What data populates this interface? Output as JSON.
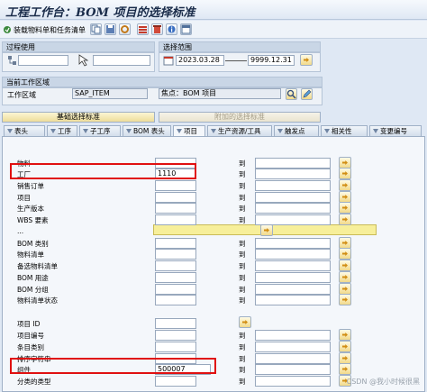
{
  "window": {
    "title": "工程工作台：BOM 项目的选择标准"
  },
  "toolbar": {
    "load_button_label": "装载物料单和任务清单",
    "icons": [
      "load-icon",
      "copy-icon",
      "save-variant-icon",
      "settings-icon",
      "get-variant-icon",
      "delete-icon",
      "info-icon",
      "layout-icon"
    ]
  },
  "process_usage": {
    "title": "过程使用",
    "field1_value": "",
    "field2_value": ""
  },
  "selection_scope": {
    "title": "选择范围",
    "date_from": "2023.03.28",
    "date_to": "9999.12.31"
  },
  "current_work_area": {
    "title": "当前工作区域",
    "label": "工作区域",
    "value": "SAP_ITEM",
    "focus_value": "焦点：BOM 项目"
  },
  "buttons": {
    "basic_criteria": "基础选择标准",
    "additional_criteria": "附加的选择标准"
  },
  "tabs": [
    {
      "label": "表头"
    },
    {
      "label": "工序"
    },
    {
      "label": "子工序"
    },
    {
      "label": "BOM 表头"
    },
    {
      "label": "项目"
    },
    {
      "label": "生产资源/工具"
    },
    {
      "label": "触发点"
    },
    {
      "label": "相关性"
    },
    {
      "label": "变更编号"
    }
  ],
  "to_label": "到",
  "rows": [
    {
      "label": "物料",
      "value": ""
    },
    {
      "label": "工厂",
      "value": "1110"
    },
    {
      "label": "销售订单",
      "value": ""
    },
    {
      "label": "项目",
      "value": ""
    },
    {
      "label": "生产版本",
      "value": ""
    },
    {
      "label": "WBS 要素",
      "value": ""
    },
    {
      "label": "...",
      "value": ""
    },
    {
      "label": "BOM 类别",
      "value": ""
    },
    {
      "label": "物料清单",
      "value": ""
    },
    {
      "label": "备选物料清单",
      "value": ""
    },
    {
      "label": "BOM 用途",
      "value": ""
    },
    {
      "label": "BOM 分组",
      "value": ""
    },
    {
      "label": "物料清单状态",
      "value": ""
    },
    {
      "label": "项目 ID",
      "value": ""
    },
    {
      "label": "项目编号",
      "value": ""
    },
    {
      "label": "条目类别",
      "value": ""
    },
    {
      "label": "排序字符串",
      "value": ""
    },
    {
      "label": "组件",
      "value": "500007"
    },
    {
      "label": "分类的类型",
      "value": ""
    }
  ],
  "watermark": "CSDN @我小时候很黑",
  "colors": {
    "highlight": "#e01010",
    "arrow": "#d18d12"
  }
}
